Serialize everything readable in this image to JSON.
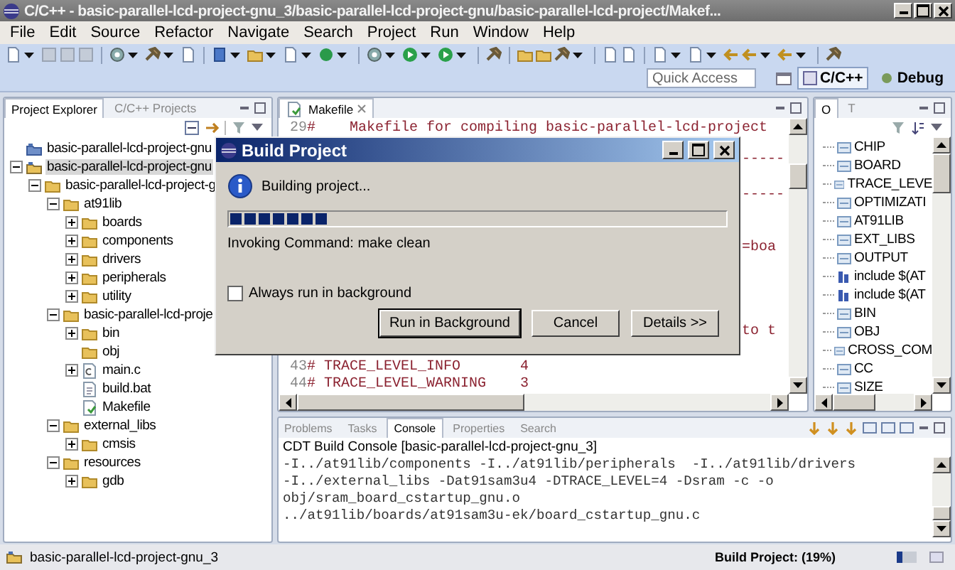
{
  "window": {
    "title": "C/C++ - basic-parallel-lcd-project-gnu_3/basic-parallel-lcd-project-gnu/basic-parallel-lcd-project/Makef..."
  },
  "menu": [
    "File",
    "Edit",
    "Source",
    "Refactor",
    "Navigate",
    "Search",
    "Project",
    "Run",
    "Window",
    "Help"
  ],
  "quick_access": {
    "placeholder": "Quick Access"
  },
  "perspectives": [
    {
      "label": "C/C++",
      "selected": true
    },
    {
      "label": "Debug",
      "selected": false
    }
  ],
  "project_explorer": {
    "tabs": [
      {
        "label": "Project Explorer",
        "selected": true
      },
      {
        "label": "C/C++ Projects",
        "selected": false
      }
    ],
    "tree": [
      {
        "label": "basic-parallel-lcd-project-gnu",
        "kind": "closed-project",
        "selected": false
      },
      {
        "label": "basic-parallel-lcd-project-gnu",
        "kind": "project",
        "expanded": true,
        "selected": true,
        "children": [
          {
            "label": "basic-parallel-lcd-project-g",
            "kind": "folder",
            "expanded": true,
            "selected": false,
            "children": [
              {
                "label": "at91lib",
                "kind": "folder",
                "expanded": true,
                "selected": false,
                "children": [
                  {
                    "label": "boards",
                    "kind": "folder",
                    "expanded": false,
                    "selected": false
                  },
                  {
                    "label": "components",
                    "kind": "folder",
                    "expanded": false,
                    "selected": false
                  },
                  {
                    "label": "drivers",
                    "kind": "folder",
                    "expanded": false,
                    "selected": false
                  },
                  {
                    "label": "peripherals",
                    "kind": "folder",
                    "expanded": false,
                    "selected": false
                  },
                  {
                    "label": "utility",
                    "kind": "folder",
                    "expanded": false,
                    "selected": false
                  }
                ]
              },
              {
                "label": "basic-parallel-lcd-proje",
                "kind": "folder",
                "expanded": true,
                "selected": false,
                "children": [
                  {
                    "label": "bin",
                    "kind": "folder",
                    "expanded": false,
                    "selected": false
                  },
                  {
                    "label": "obj",
                    "kind": "folder",
                    "selected": false
                  },
                  {
                    "label": "main.c",
                    "kind": "c-file",
                    "expanded": false,
                    "selected": false
                  },
                  {
                    "label": "build.bat",
                    "kind": "text-file",
                    "selected": false
                  },
                  {
                    "label": "Makefile",
                    "kind": "makefile",
                    "selected": false
                  }
                ]
              },
              {
                "label": "external_libs",
                "kind": "folder",
                "expanded": true,
                "selected": false,
                "children": [
                  {
                    "label": "cmsis",
                    "kind": "folder",
                    "expanded": false,
                    "selected": false
                  }
                ]
              },
              {
                "label": "resources",
                "kind": "folder",
                "expanded": true,
                "selected": false,
                "children": [
                  {
                    "label": "gdb",
                    "kind": "folder",
                    "expanded": false,
                    "selected": false
                  }
                ]
              }
            ]
          }
        ]
      }
    ]
  },
  "editor": {
    "tab": "Makefile",
    "lines_top": [
      {
        "number": "29",
        "code": "#    Makefile for compiling basic-parallel-lcd-project"
      }
    ],
    "fragments": [
      "-----",
      "-----",
      "=boa",
      "to t"
    ],
    "lines_bottom": [
      {
        "number": "43",
        "code": "# TRACE_LEVEL_INFO       4"
      },
      {
        "number": "44",
        "code": "# TRACE_LEVEL_WARNING    3"
      }
    ]
  },
  "outline": {
    "tabs": [
      {
        "label": "O",
        "selected": true
      },
      {
        "label": "T",
        "selected": false
      }
    ],
    "items": [
      {
        "kind": "variable",
        "label": "CHIP"
      },
      {
        "kind": "variable",
        "label": "BOARD"
      },
      {
        "kind": "variable",
        "label": "TRACE_LEVE"
      },
      {
        "kind": "variable",
        "label": "OPTIMIZATI"
      },
      {
        "kind": "variable",
        "label": "AT91LIB"
      },
      {
        "kind": "variable",
        "label": "EXT_LIBS"
      },
      {
        "kind": "variable",
        "label": "OUTPUT"
      },
      {
        "kind": "include",
        "label": "include $(AT"
      },
      {
        "kind": "include",
        "label": "include $(AT"
      },
      {
        "kind": "variable",
        "label": "BIN"
      },
      {
        "kind": "variable",
        "label": "OBJ"
      },
      {
        "kind": "variable",
        "label": "CROSS_COM"
      },
      {
        "kind": "variable",
        "label": "CC"
      },
      {
        "kind": "variable",
        "label": "SIZE"
      }
    ]
  },
  "console": {
    "tabs": [
      {
        "label": "Problems",
        "selected": false
      },
      {
        "label": "Tasks",
        "selected": false
      },
      {
        "label": "Console",
        "selected": true
      },
      {
        "label": "Properties",
        "selected": false
      },
      {
        "label": "Search",
        "selected": false
      }
    ],
    "title": "CDT Build Console [basic-parallel-lcd-project-gnu_3]",
    "lines": [
      "-I../at91lib/components -I../at91lib/peripherals  -I../at91lib/drivers",
      "-I../external_libs -Dat91sam3u4 -DTRACE_LEVEL=4 -Dsram -c -o",
      "obj/sram_board_cstartup_gnu.o",
      "../at91lib/boards/at91sam3u-ek/board_cstartup_gnu.c"
    ]
  },
  "status_bar": {
    "project": "basic-parallel-lcd-project-gnu_3",
    "progress": "Build Project: (19%)"
  },
  "dialog": {
    "title": "Build Project",
    "message": "Building project...",
    "level": 0.2,
    "command": "Invoking Command: make clean",
    "checkbox": {
      "label": "Always run in background",
      "checked": false
    },
    "buttons": [
      {
        "label": "Run in Background",
        "default": true
      },
      {
        "label": "Cancel",
        "default": false
      },
      {
        "label": "Details >>",
        "default": false
      }
    ]
  }
}
